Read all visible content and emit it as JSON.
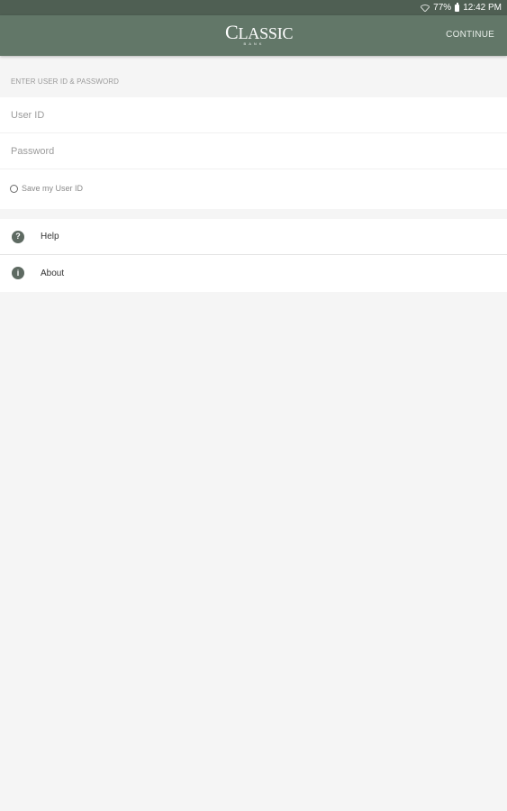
{
  "status_bar": {
    "battery": "77%",
    "time": "12:42 PM"
  },
  "app_bar": {
    "logo_main": "LASSIC",
    "logo_initial": "C",
    "logo_sub": "BANK",
    "continue_label": "CONTINUE"
  },
  "login": {
    "section_header": "ENTER USER ID & PASSWORD",
    "user_id_placeholder": "User ID",
    "password_placeholder": "Password",
    "save_user_id_label": "Save my User ID"
  },
  "menu": {
    "items": [
      {
        "label": "Help",
        "icon": "help-icon",
        "glyph": "?"
      },
      {
        "label": "About",
        "icon": "info-icon",
        "glyph": "i"
      }
    ]
  },
  "colors": {
    "status_bar": "#4f5f53",
    "app_bar": "#627768",
    "icon": "#5e6a62",
    "background": "#f5f5f5"
  }
}
